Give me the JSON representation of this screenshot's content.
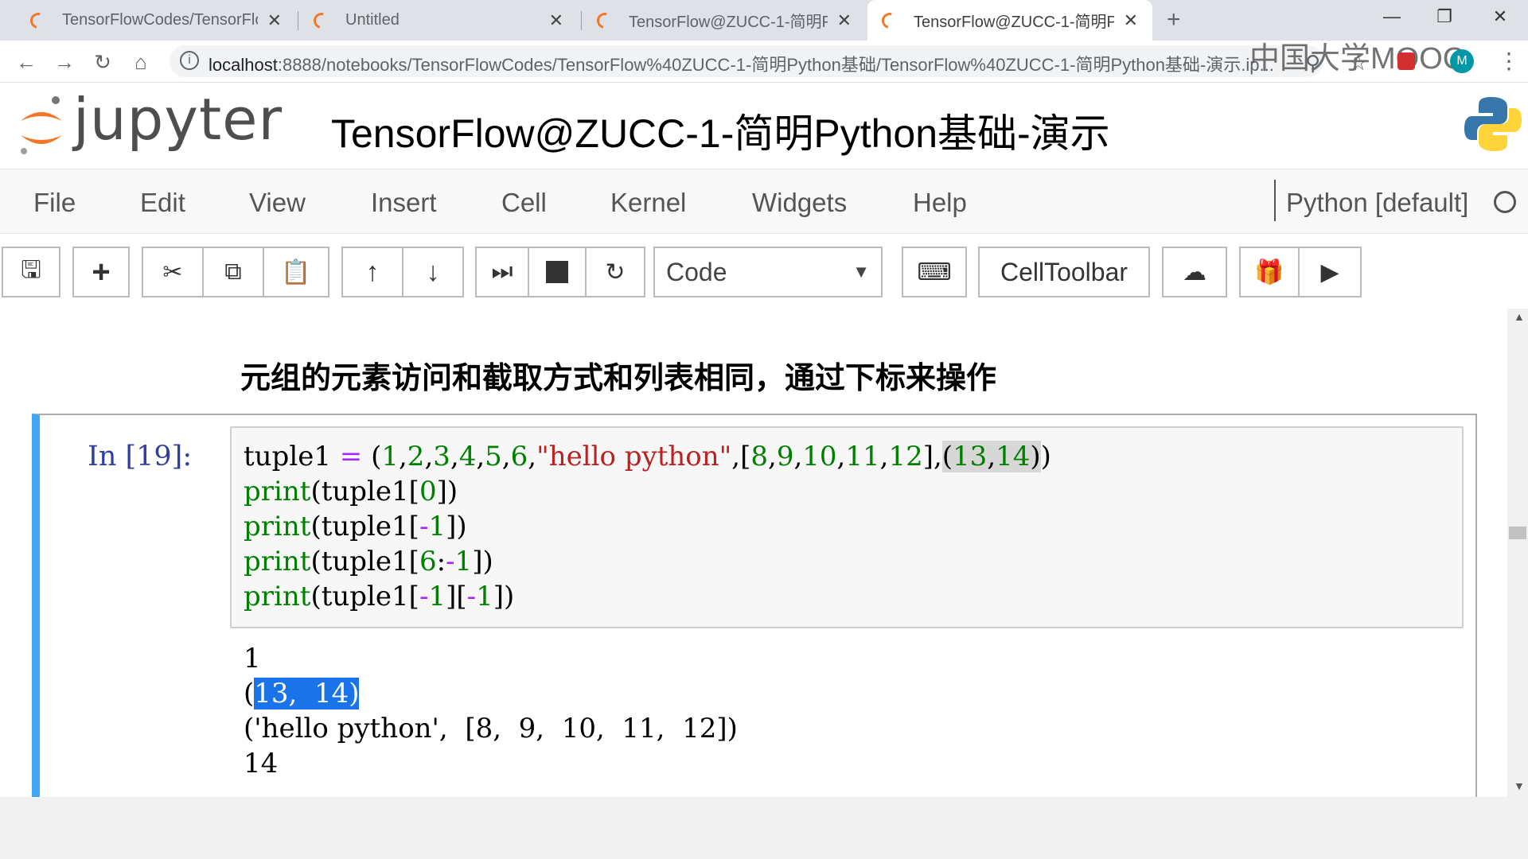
{
  "browser": {
    "tabs": [
      {
        "title": "TensorFlowCodes/TensorFlow",
        "active": false
      },
      {
        "title": "Untitled",
        "active": false
      },
      {
        "title": "TensorFlow@ZUCC-1-简明Pytl",
        "active": false
      },
      {
        "title": "TensorFlow@ZUCC-1-简明Pytl",
        "active": true
      }
    ],
    "url_host": "localhost",
    "url_path": ":8888/notebooks/TensorFlowCodes/TensorFlow%40ZUCC-1-简明Python基础/TensorFlow%40ZUCC-1-简明Python基础-演示.ip...",
    "watermark": "中国大学MOOC"
  },
  "jupyter": {
    "logo_text": "jupyter",
    "notebook_title": "TensorFlow@ZUCC-1-简明Python基础-演示",
    "menus": [
      "File",
      "Edit",
      "View",
      "Insert",
      "Cell",
      "Kernel",
      "Widgets",
      "Help"
    ],
    "kernel_name": "Python [default]",
    "cell_type": "Code",
    "celltoolbar_label": "CellToolbar"
  },
  "notebook": {
    "markdown_heading": "元组的元素访问和截取方式和列表相同，通过下标来操作",
    "cell_prompt": "In  [19]:",
    "output_lines": [
      "1",
      "(13,  14)",
      "('hello python',  [8,  9,  10,  11,  12])",
      "14"
    ]
  },
  "colors": {
    "accent": "#42a5f5",
    "prompt": "#303f9f",
    "keyword": "#008000",
    "string": "#ba2121",
    "selection": "#1a73e8"
  }
}
